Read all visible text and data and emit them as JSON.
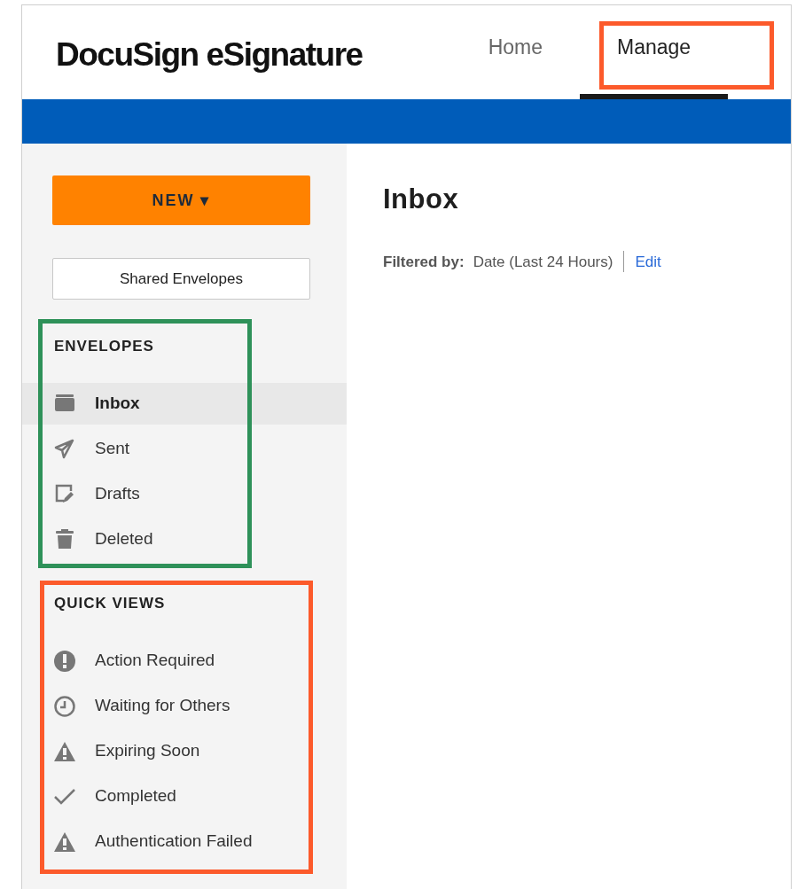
{
  "header": {
    "logo": "DocuSign eSignature",
    "tabs": [
      {
        "label": "Home",
        "selected": false
      },
      {
        "label": "Manage",
        "selected": true
      }
    ]
  },
  "sidebar": {
    "new_button": "NEW ▾",
    "shared_button": "Shared Envelopes",
    "sections": [
      {
        "heading": "ENVELOPES",
        "items": [
          {
            "label": "Inbox",
            "kind": "inbox",
            "selected": true
          },
          {
            "label": "Sent",
            "kind": "sent",
            "selected": false
          },
          {
            "label": "Drafts",
            "kind": "drafts",
            "selected": false
          },
          {
            "label": "Deleted",
            "kind": "trash",
            "selected": false
          }
        ]
      },
      {
        "heading": "QUICK VIEWS",
        "items": [
          {
            "label": "Action Required",
            "kind": "alert",
            "selected": false
          },
          {
            "label": "Waiting for Others",
            "kind": "clock",
            "selected": false
          },
          {
            "label": "Expiring Soon",
            "kind": "warning",
            "selected": false
          },
          {
            "label": "Completed",
            "kind": "check",
            "selected": false
          },
          {
            "label": "Authentication Failed",
            "kind": "warning",
            "selected": false
          }
        ]
      }
    ]
  },
  "main": {
    "title": "Inbox",
    "filter_label": "Filtered by:",
    "filter_value": "Date (Last 24 Hours)",
    "edit_link": "Edit"
  },
  "highlights": [
    {
      "color": "#fc5a2b"
    },
    {
      "color": "#2e9159"
    },
    {
      "color": "#fc5a2b"
    }
  ]
}
